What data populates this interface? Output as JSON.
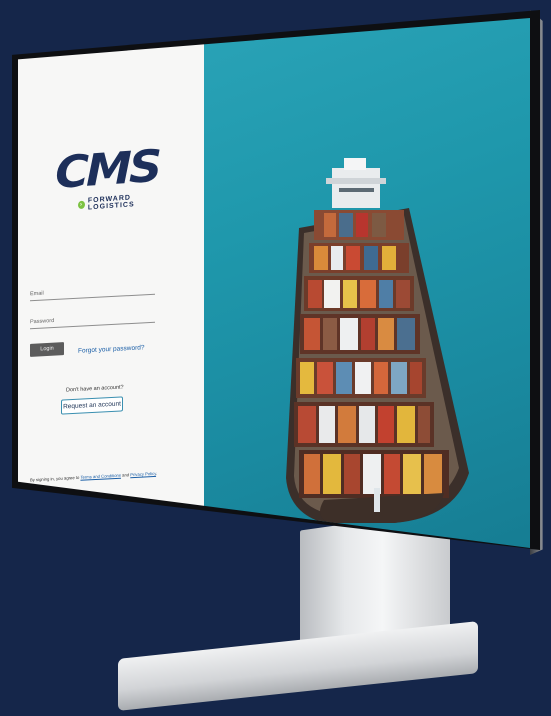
{
  "logo": {
    "brand": "CMS",
    "tagline": "FORWARD LOGISTICS"
  },
  "login": {
    "email_label": "Email",
    "password_label": "Password",
    "login_button": "Login",
    "forgot_link": "Forgot your password?",
    "no_account_text": "Don't have an account?",
    "request_button": "Request an account",
    "terms_prefix": "By signing in, you agree to ",
    "terms_link": "Terms and Conditions",
    "terms_mid": " and ",
    "privacy_link": "Privacy Policy",
    "terms_suffix": "."
  },
  "colors": {
    "background": "#15264a",
    "brand_navy": "#1d2f5a",
    "brand_green": "#7cc242",
    "sea": "#1f98ac",
    "link": "#1b5fa7"
  },
  "icons": {
    "tag_arrow": "arrow-right-icon"
  }
}
